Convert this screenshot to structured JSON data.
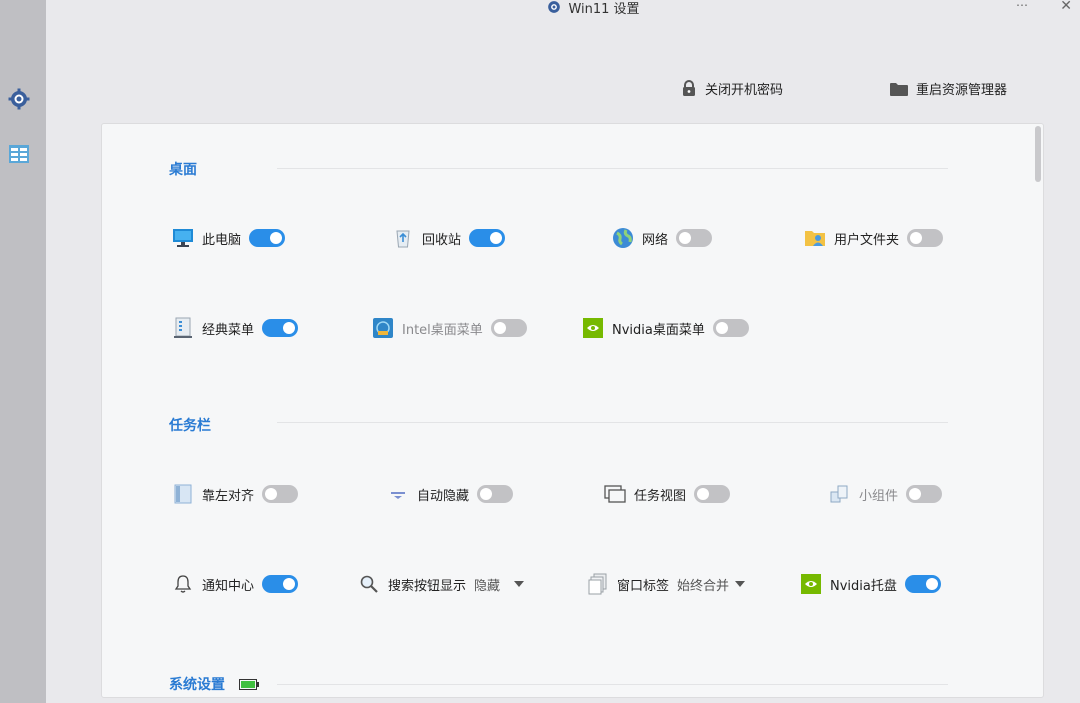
{
  "window": {
    "title": "Win11 设置",
    "minimize_glyph": "⋯",
    "close_glyph": "✕"
  },
  "top_actions": {
    "close_password": "关闭开机密码",
    "restart_explorer": "重启资源管理器"
  },
  "sections": {
    "desktop": "桌面",
    "taskbar": "任务栏",
    "system": "系统设置"
  },
  "desktop_items": {
    "this_pc": {
      "label": "此电脑",
      "on": true
    },
    "recycle_bin": {
      "label": "回收站",
      "on": true
    },
    "network": {
      "label": "网络",
      "on": false
    },
    "user_folder": {
      "label": "用户文件夹",
      "on": false
    },
    "classic_menu": {
      "label": "经典菜单",
      "on": true
    },
    "intel_menu": {
      "label": "Intel桌面菜单",
      "on": false
    },
    "nvidia_menu": {
      "label": "Nvidia桌面菜单",
      "on": false
    }
  },
  "taskbar_items": {
    "align_left": {
      "label": "靠左对齐",
      "on": false
    },
    "auto_hide": {
      "label": "自动隐藏",
      "on": false
    },
    "task_view": {
      "label": "任务视图",
      "on": false
    },
    "widgets": {
      "label": "小组件",
      "on": false
    },
    "notification_center": {
      "label": "通知中心",
      "on": true
    },
    "search_button": {
      "label": "搜索按钮显示",
      "value": "隐藏"
    },
    "window_tabs": {
      "label": "窗口标签",
      "value": "始终合并"
    },
    "nvidia_tray": {
      "label": "Nvidia托盘",
      "on": true
    }
  },
  "colors": {
    "accent": "#2a8ee8",
    "section_heading": "#2a7bd3",
    "toggle_off": "#c2c2c5"
  }
}
